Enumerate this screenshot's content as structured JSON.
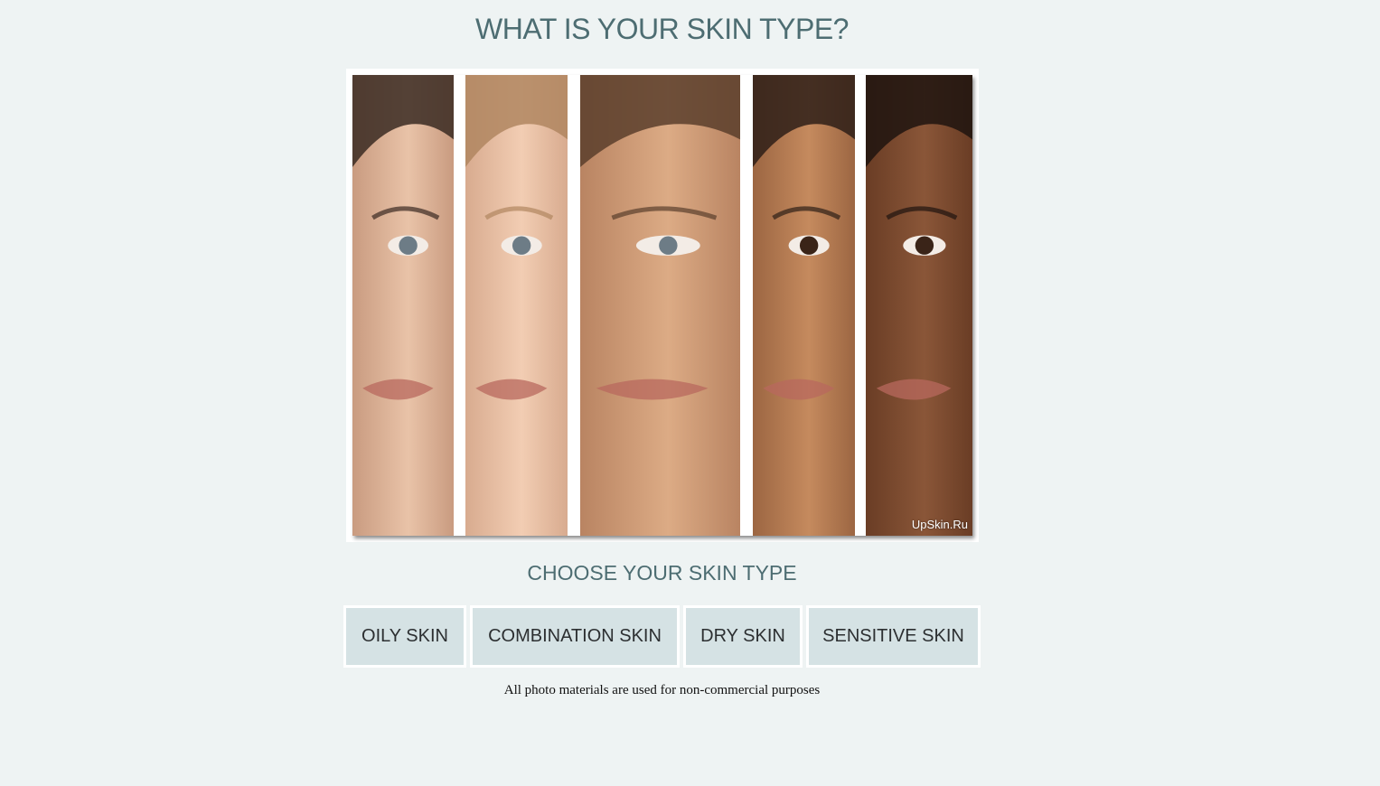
{
  "header": {
    "title": "WHAT IS YOUR SKIN TYPE?"
  },
  "photo": {
    "description_icon": "skin-tones-collage",
    "watermark": "UpSkin.Ru",
    "panels": [
      {
        "tone": "#e9c3a8",
        "shade": "#c99b80",
        "hair": "#3a2a22"
      },
      {
        "tone": "#f2cdb3",
        "shade": "#d8ab8f",
        "hair": "#b08660"
      },
      {
        "tone": "#dcab85",
        "shade": "#b98462",
        "hair": "#5a3e2c"
      },
      {
        "tone": "#c58a5e",
        "shade": "#9c6642",
        "hair": "#2e1f17"
      },
      {
        "tone": "#8a5638",
        "shade": "#6a3d25",
        "hair": "#1f140f"
      }
    ]
  },
  "choose": {
    "title": "CHOOSE YOUR SKIN TYPE",
    "options": [
      {
        "label": "OILY SKIN"
      },
      {
        "label": "COMBINATION SKIN"
      },
      {
        "label": "DRY SKIN"
      },
      {
        "label": "SENSITIVE SKIN"
      }
    ]
  },
  "footer": {
    "disclaimer": "All photo materials are used for non-commercial purposes"
  },
  "colors": {
    "background": "#eef3f3",
    "heading": "#4d6d72",
    "button_bg": "#d5e2e4",
    "button_border": "#ffffff"
  }
}
